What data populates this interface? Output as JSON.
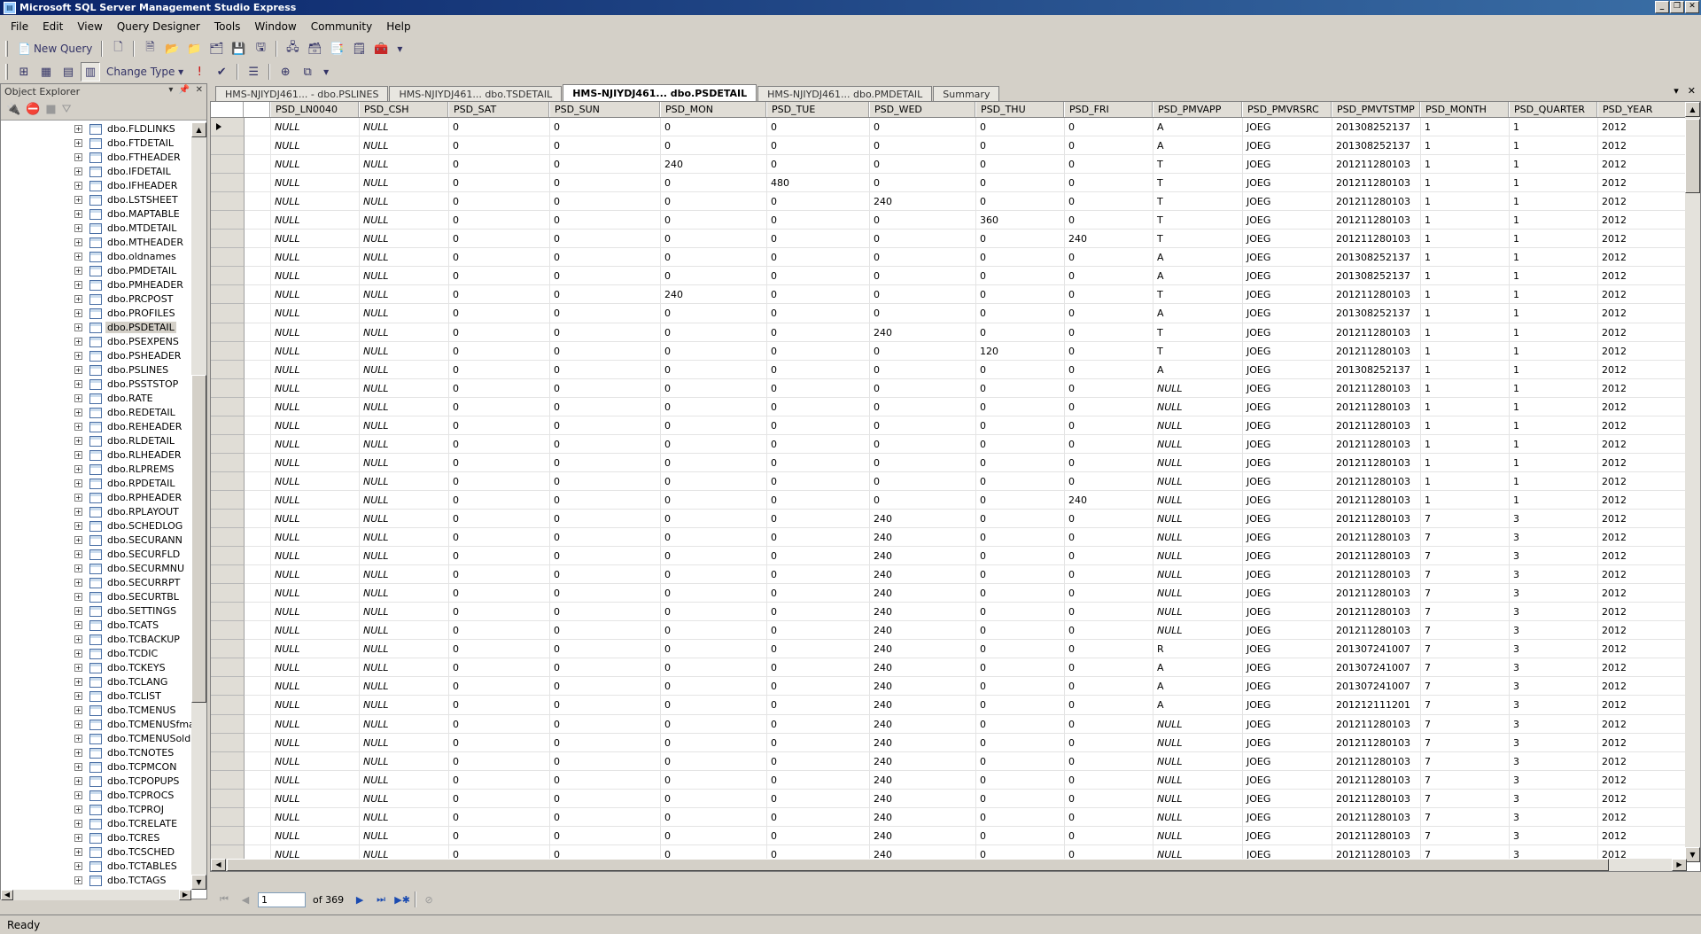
{
  "app": {
    "title": "Microsoft SQL Server Management Studio Express"
  },
  "menu": [
    "File",
    "Edit",
    "View",
    "Query Designer",
    "Tools",
    "Window",
    "Community",
    "Help"
  ],
  "toolbar": {
    "new_query_label": "New Query",
    "change_type_label": "Change Type"
  },
  "object_explorer": {
    "title": "Object Explorer",
    "selected": "dbo.PSDETAIL",
    "items": [
      "dbo.FLDLINKS",
      "dbo.FTDETAIL",
      "dbo.FTHEADER",
      "dbo.IFDETAIL",
      "dbo.IFHEADER",
      "dbo.LSTSHEET",
      "dbo.MAPTABLE",
      "dbo.MTDETAIL",
      "dbo.MTHEADER",
      "dbo.oldnames",
      "dbo.PMDETAIL",
      "dbo.PMHEADER",
      "dbo.PRCPOST",
      "dbo.PROFILES",
      "dbo.PSDETAIL",
      "dbo.PSEXPENS",
      "dbo.PSHEADER",
      "dbo.PSLINES",
      "dbo.PSSTSTOP",
      "dbo.RATE",
      "dbo.REDETAIL",
      "dbo.REHEADER",
      "dbo.RLDETAIL",
      "dbo.RLHEADER",
      "dbo.RLPREMS",
      "dbo.RPDETAIL",
      "dbo.RPHEADER",
      "dbo.RPLAYOUT",
      "dbo.SCHEDLOG",
      "dbo.SECURANN",
      "dbo.SECURFLD",
      "dbo.SECURMNU",
      "dbo.SECURRPT",
      "dbo.SECURTBL",
      "dbo.SETTINGS",
      "dbo.TCATS",
      "dbo.TCBACKUP",
      "dbo.TCDIC",
      "dbo.TCKEYS",
      "dbo.TCLANG",
      "dbo.TCLIST",
      "dbo.TCMENUS",
      "dbo.TCMENUSfmac",
      "dbo.TCMENUSold",
      "dbo.TCNOTES",
      "dbo.TCPMCON",
      "dbo.TCPOPUPS",
      "dbo.TCPROCS",
      "dbo.TCPROJ",
      "dbo.TCRELATE",
      "dbo.TCRES",
      "dbo.TCSCHED",
      "dbo.TCTABLES",
      "dbo.TCTAGS",
      "dbo.TCTEXT"
    ]
  },
  "tabs": [
    {
      "label": "HMS-NJIYDJ461... - dbo.PSLINES",
      "active": false
    },
    {
      "label": "HMS-NJIYDJ461... dbo.TSDETAIL",
      "active": false
    },
    {
      "label": "HMS-NJIYDJ461... dbo.PSDETAIL",
      "active": true
    },
    {
      "label": "HMS-NJIYDJ461... dbo.PMDETAIL",
      "active": false
    },
    {
      "label": "Summary",
      "active": false
    }
  ],
  "grid": {
    "columns": [
      "PSD_LN0040",
      "PSD_CSH",
      "PSD_SAT",
      "PSD_SUN",
      "PSD_MON",
      "PSD_TUE",
      "PSD_WED",
      "PSD_THU",
      "PSD_FRI",
      "PSD_PMVAPP",
      "PSD_PMVRSRC",
      "PSD_PMVTSTMP",
      "PSD_MONTH",
      "PSD_QUARTER",
      "PSD_YEAR"
    ],
    "rows": [
      [
        "NULL",
        "NULL",
        "0",
        "0",
        "0",
        "0",
        "0",
        "0",
        "0",
        "A",
        "JOEG",
        "201308252137",
        "1",
        "1",
        "2012"
      ],
      [
        "NULL",
        "NULL",
        "0",
        "0",
        "0",
        "0",
        "0",
        "0",
        "0",
        "A",
        "JOEG",
        "201308252137",
        "1",
        "1",
        "2012"
      ],
      [
        "NULL",
        "NULL",
        "0",
        "0",
        "240",
        "0",
        "0",
        "0",
        "0",
        "T",
        "JOEG",
        "201211280103",
        "1",
        "1",
        "2012"
      ],
      [
        "NULL",
        "NULL",
        "0",
        "0",
        "0",
        "480",
        "0",
        "0",
        "0",
        "T",
        "JOEG",
        "201211280103",
        "1",
        "1",
        "2012"
      ],
      [
        "NULL",
        "NULL",
        "0",
        "0",
        "0",
        "0",
        "240",
        "0",
        "0",
        "T",
        "JOEG",
        "201211280103",
        "1",
        "1",
        "2012"
      ],
      [
        "NULL",
        "NULL",
        "0",
        "0",
        "0",
        "0",
        "0",
        "360",
        "0",
        "T",
        "JOEG",
        "201211280103",
        "1",
        "1",
        "2012"
      ],
      [
        "NULL",
        "NULL",
        "0",
        "0",
        "0",
        "0",
        "0",
        "0",
        "240",
        "T",
        "JOEG",
        "201211280103",
        "1",
        "1",
        "2012"
      ],
      [
        "NULL",
        "NULL",
        "0",
        "0",
        "0",
        "0",
        "0",
        "0",
        "0",
        "A",
        "JOEG",
        "201308252137",
        "1",
        "1",
        "2012"
      ],
      [
        "NULL",
        "NULL",
        "0",
        "0",
        "0",
        "0",
        "0",
        "0",
        "0",
        "A",
        "JOEG",
        "201308252137",
        "1",
        "1",
        "2012"
      ],
      [
        "NULL",
        "NULL",
        "0",
        "0",
        "240",
        "0",
        "0",
        "0",
        "0",
        "T",
        "JOEG",
        "201211280103",
        "1",
        "1",
        "2012"
      ],
      [
        "NULL",
        "NULL",
        "0",
        "0",
        "0",
        "0",
        "0",
        "0",
        "0",
        "A",
        "JOEG",
        "201308252137",
        "1",
        "1",
        "2012"
      ],
      [
        "NULL",
        "NULL",
        "0",
        "0",
        "0",
        "0",
        "240",
        "0",
        "0",
        "T",
        "JOEG",
        "201211280103",
        "1",
        "1",
        "2012"
      ],
      [
        "NULL",
        "NULL",
        "0",
        "0",
        "0",
        "0",
        "0",
        "120",
        "0",
        "T",
        "JOEG",
        "201211280103",
        "1",
        "1",
        "2012"
      ],
      [
        "NULL",
        "NULL",
        "0",
        "0",
        "0",
        "0",
        "0",
        "0",
        "0",
        "A",
        "JOEG",
        "201308252137",
        "1",
        "1",
        "2012"
      ],
      [
        "NULL",
        "NULL",
        "0",
        "0",
        "0",
        "0",
        "0",
        "0",
        "0",
        "NULL",
        "JOEG",
        "201211280103",
        "1",
        "1",
        "2012"
      ],
      [
        "NULL",
        "NULL",
        "0",
        "0",
        "0",
        "0",
        "0",
        "0",
        "0",
        "NULL",
        "JOEG",
        "201211280103",
        "1",
        "1",
        "2012"
      ],
      [
        "NULL",
        "NULL",
        "0",
        "0",
        "0",
        "0",
        "0",
        "0",
        "0",
        "NULL",
        "JOEG",
        "201211280103",
        "1",
        "1",
        "2012"
      ],
      [
        "NULL",
        "NULL",
        "0",
        "0",
        "0",
        "0",
        "0",
        "0",
        "0",
        "NULL",
        "JOEG",
        "201211280103",
        "1",
        "1",
        "2012"
      ],
      [
        "NULL",
        "NULL",
        "0",
        "0",
        "0",
        "0",
        "0",
        "0",
        "0",
        "NULL",
        "JOEG",
        "201211280103",
        "1",
        "1",
        "2012"
      ],
      [
        "NULL",
        "NULL",
        "0",
        "0",
        "0",
        "0",
        "0",
        "0",
        "0",
        "NULL",
        "JOEG",
        "201211280103",
        "1",
        "1",
        "2012"
      ],
      [
        "NULL",
        "NULL",
        "0",
        "0",
        "0",
        "0",
        "0",
        "0",
        "240",
        "NULL",
        "JOEG",
        "201211280103",
        "1",
        "1",
        "2012"
      ],
      [
        "NULL",
        "NULL",
        "0",
        "0",
        "0",
        "0",
        "240",
        "0",
        "0",
        "NULL",
        "JOEG",
        "201211280103",
        "7",
        "3",
        "2012"
      ],
      [
        "NULL",
        "NULL",
        "0",
        "0",
        "0",
        "0",
        "240",
        "0",
        "0",
        "NULL",
        "JOEG",
        "201211280103",
        "7",
        "3",
        "2012"
      ],
      [
        "NULL",
        "NULL",
        "0",
        "0",
        "0",
        "0",
        "240",
        "0",
        "0",
        "NULL",
        "JOEG",
        "201211280103",
        "7",
        "3",
        "2012"
      ],
      [
        "NULL",
        "NULL",
        "0",
        "0",
        "0",
        "0",
        "240",
        "0",
        "0",
        "NULL",
        "JOEG",
        "201211280103",
        "7",
        "3",
        "2012"
      ],
      [
        "NULL",
        "NULL",
        "0",
        "0",
        "0",
        "0",
        "240",
        "0",
        "0",
        "NULL",
        "JOEG",
        "201211280103",
        "7",
        "3",
        "2012"
      ],
      [
        "NULL",
        "NULL",
        "0",
        "0",
        "0",
        "0",
        "240",
        "0",
        "0",
        "NULL",
        "JOEG",
        "201211280103",
        "7",
        "3",
        "2012"
      ],
      [
        "NULL",
        "NULL",
        "0",
        "0",
        "0",
        "0",
        "240",
        "0",
        "0",
        "NULL",
        "JOEG",
        "201211280103",
        "7",
        "3",
        "2012"
      ],
      [
        "NULL",
        "NULL",
        "0",
        "0",
        "0",
        "0",
        "240",
        "0",
        "0",
        "R",
        "JOEG",
        "201307241007",
        "7",
        "3",
        "2012"
      ],
      [
        "NULL",
        "NULL",
        "0",
        "0",
        "0",
        "0",
        "240",
        "0",
        "0",
        "A",
        "JOEG",
        "201307241007",
        "7",
        "3",
        "2012"
      ],
      [
        "NULL",
        "NULL",
        "0",
        "0",
        "0",
        "0",
        "240",
        "0",
        "0",
        "A",
        "JOEG",
        "201307241007",
        "7",
        "3",
        "2012"
      ],
      [
        "NULL",
        "NULL",
        "0",
        "0",
        "0",
        "0",
        "240",
        "0",
        "0",
        "A",
        "JOEG",
        "201212111201",
        "7",
        "3",
        "2012"
      ],
      [
        "NULL",
        "NULL",
        "0",
        "0",
        "0",
        "0",
        "240",
        "0",
        "0",
        "NULL",
        "JOEG",
        "201211280103",
        "7",
        "3",
        "2012"
      ],
      [
        "NULL",
        "NULL",
        "0",
        "0",
        "0",
        "0",
        "240",
        "0",
        "0",
        "NULL",
        "JOEG",
        "201211280103",
        "7",
        "3",
        "2012"
      ],
      [
        "NULL",
        "NULL",
        "0",
        "0",
        "0",
        "0",
        "240",
        "0",
        "0",
        "NULL",
        "JOEG",
        "201211280103",
        "7",
        "3",
        "2012"
      ],
      [
        "NULL",
        "NULL",
        "0",
        "0",
        "0",
        "0",
        "240",
        "0",
        "0",
        "NULL",
        "JOEG",
        "201211280103",
        "7",
        "3",
        "2012"
      ],
      [
        "NULL",
        "NULL",
        "0",
        "0",
        "0",
        "0",
        "240",
        "0",
        "0",
        "NULL",
        "JOEG",
        "201211280103",
        "7",
        "3",
        "2012"
      ],
      [
        "NULL",
        "NULL",
        "0",
        "0",
        "0",
        "0",
        "240",
        "0",
        "0",
        "NULL",
        "JOEG",
        "201211280103",
        "7",
        "3",
        "2012"
      ],
      [
        "NULL",
        "NULL",
        "0",
        "0",
        "0",
        "0",
        "240",
        "0",
        "0",
        "NULL",
        "JOEG",
        "201211280103",
        "7",
        "3",
        "2012"
      ],
      [
        "NULL",
        "NULL",
        "0",
        "0",
        "0",
        "0",
        "240",
        "0",
        "0",
        "NULL",
        "JOEG",
        "201211280103",
        "7",
        "3",
        "2012"
      ],
      [
        "NULL",
        "NULL",
        "0",
        "0",
        "0",
        "0",
        "240",
        "0",
        "0",
        "NULL",
        "JOEG",
        "201211280103",
        "7",
        "3",
        "2012"
      ]
    ]
  },
  "navigation": {
    "current_record": "1",
    "total_text": "of 369"
  },
  "status": {
    "text": "Ready"
  }
}
